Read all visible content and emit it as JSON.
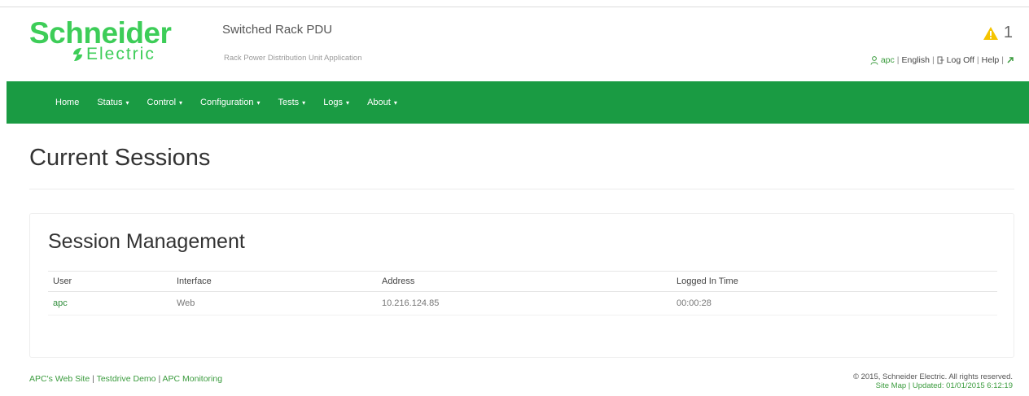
{
  "brand": {
    "logo_word": "Schneider",
    "logo_word2": "Electric",
    "app_title": "Switched Rack PDU",
    "app_subtitle": "Rack Power Distribution Unit Application",
    "accent_color": "#1a9b43"
  },
  "alarm": {
    "icon": "warning-triangle-icon",
    "count": "1"
  },
  "userbar": {
    "user": "apc",
    "language": "English",
    "logoff": "Log Off",
    "help": "Help"
  },
  "nav": {
    "items": [
      {
        "label": "Home",
        "has_menu": false
      },
      {
        "label": "Status",
        "has_menu": true
      },
      {
        "label": "Control",
        "has_menu": true
      },
      {
        "label": "Configuration",
        "has_menu": true
      },
      {
        "label": "Tests",
        "has_menu": true
      },
      {
        "label": "Logs",
        "has_menu": true
      },
      {
        "label": "About",
        "has_menu": true
      }
    ]
  },
  "page": {
    "title": "Current Sessions"
  },
  "panel": {
    "title": "Session Management",
    "columns": [
      "User",
      "Interface",
      "Address",
      "Logged In Time"
    ],
    "rows": [
      {
        "user": "apc",
        "interface": "Web",
        "address": "10.216.124.85",
        "logged_in_time": "00:00:28"
      }
    ]
  },
  "footer": {
    "link1": "APC's Web Site",
    "link2": "Testdrive Demo",
    "link3": "APC Monitoring",
    "copyright": "© 2015, Schneider Electric. All rights reserved.",
    "version_line": "Site Map | Updated: 01/01/2015 6:12:19"
  }
}
